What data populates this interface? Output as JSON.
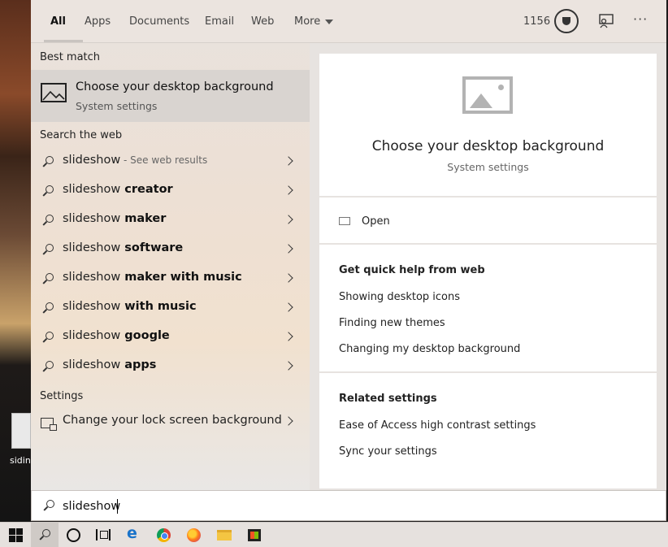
{
  "desktop": {
    "icon_label": "sidin"
  },
  "tabs": [
    {
      "label": "All"
    },
    {
      "label": "Apps"
    },
    {
      "label": "Documents"
    },
    {
      "label": "Email"
    },
    {
      "label": "Web"
    },
    {
      "label": "More"
    }
  ],
  "header": {
    "points": "1156"
  },
  "best_match": {
    "heading": "Best match",
    "title": "Choose your desktop background",
    "subtitle": "System settings"
  },
  "web": {
    "heading": "Search the web",
    "items": [
      {
        "query": "slideshow",
        "bold": "",
        "hint": " - See web results"
      },
      {
        "query": "slideshow",
        "bold": " creator",
        "hint": ""
      },
      {
        "query": "slideshow",
        "bold": " maker",
        "hint": ""
      },
      {
        "query": "slideshow",
        "bold": " software",
        "hint": ""
      },
      {
        "query": "slideshow",
        "bold": " maker with music",
        "hint": ""
      },
      {
        "query": "slideshow",
        "bold": " with music",
        "hint": ""
      },
      {
        "query": "slideshow",
        "bold": " google",
        "hint": ""
      },
      {
        "query": "slideshow",
        "bold": " apps",
        "hint": ""
      }
    ]
  },
  "settings": {
    "heading": "Settings",
    "item": "Change your lock screen background"
  },
  "preview": {
    "title": "Choose your desktop background",
    "subtitle": "System settings",
    "open_label": "Open",
    "quick_help_heading": "Get quick help from web",
    "quick_help_links": [
      "Showing desktop icons",
      "Finding new themes",
      "Changing my desktop background"
    ],
    "related_heading": "Related settings",
    "related_links": [
      "Ease of Access high contrast settings",
      "Sync your settings"
    ]
  },
  "search": {
    "value": "slideshow"
  },
  "taskbar": {
    "icons": [
      "windows-start-icon",
      "search-icon",
      "cortana-icon",
      "task-view-icon",
      "edge-icon",
      "chrome-icon",
      "firefox-icon",
      "file-explorer-icon",
      "store-icon"
    ]
  }
}
